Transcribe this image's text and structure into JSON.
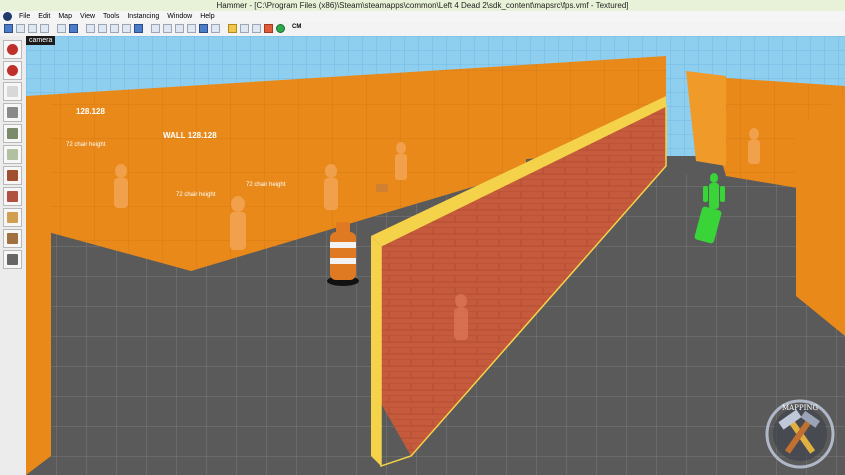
{
  "window": {
    "title": "Hammer - [C:\\Program Files (x86)\\Steam\\steamapps\\common\\Left 4 Dead 2\\sdk_content\\mapsrc\\fps.vmf - Textured]"
  },
  "menu": [
    "File",
    "Edit",
    "Map",
    "View",
    "Tools",
    "Instancing",
    "Window",
    "Help"
  ],
  "toolbar": {
    "cm_label": "CM",
    "button_icons": [
      "grid-icon",
      "grid-smaller-icon",
      "grid-larger-icon",
      "3d-grid-icon",
      "undo-icon",
      "redo-icon",
      "carve-icon",
      "group-icon",
      "ungroup-icon",
      "hide-icon",
      "show-icon",
      "cut-icon",
      "copy-icon",
      "paste-icon",
      "texture-lock-icon",
      "snap-icon",
      "camera-icon",
      "zoom-icon",
      "visgroup-icon",
      "entity-report-icon",
      "check-problems-icon",
      "run-map-icon"
    ]
  },
  "tools": [
    "selection-tool-icon",
    "magnify-tool-icon",
    "camera-tool-icon",
    "entity-tool-icon",
    "block-tool-icon",
    "texture-application-icon",
    "apply-texture-icon",
    "decal-tool-icon",
    "overlay-tool-icon",
    "clipping-tool-icon",
    "vertex-tool-icon"
  ],
  "viewport": {
    "label": "camera",
    "wall_labels": [
      "72 chair height",
      "72 chair height",
      "WALL 128.128",
      "128.128",
      "72 chair height"
    ],
    "logo_text": "MAPPING"
  },
  "colors": {
    "orange_wall": "#e8891a",
    "floor": "#5c5c5c",
    "red_wall": "#c85a3a",
    "sky": "#8ecff0",
    "player_green": "#38d438"
  }
}
